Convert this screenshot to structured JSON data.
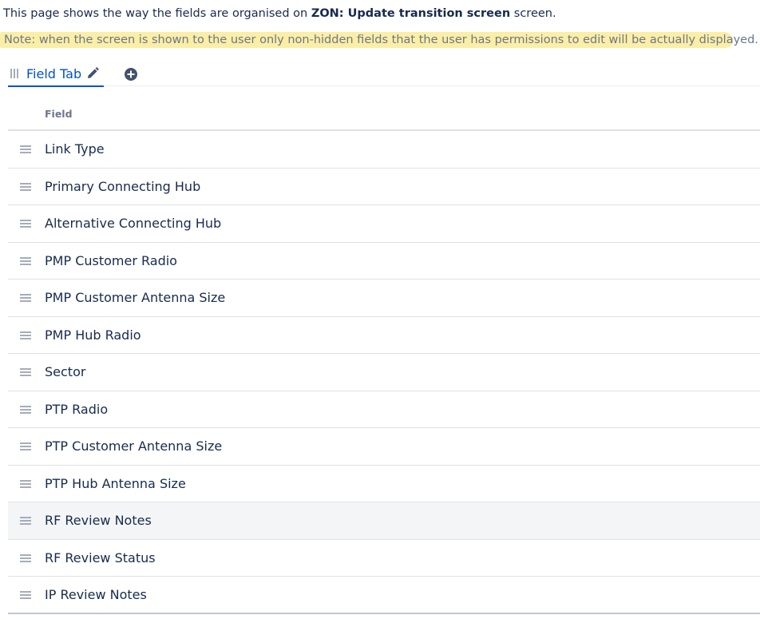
{
  "intro": {
    "prefix": "This page shows the way the fields are organised on ",
    "screen_name": "ZON: Update transition screen",
    "suffix": " screen."
  },
  "note": "Note: when the screen is shown to the user only non-hidden fields that the user has permissions to edit will be actually displayed.",
  "tabs": [
    {
      "label": "Field Tab"
    }
  ],
  "table": {
    "column_header": "Field",
    "rows": [
      {
        "label": "Link Type"
      },
      {
        "label": "Primary Connecting Hub"
      },
      {
        "label": "Alternative Connecting Hub"
      },
      {
        "label": "PMP Customer Radio"
      },
      {
        "label": "PMP Customer Antenna Size"
      },
      {
        "label": "PMP Hub Radio"
      },
      {
        "label": "Sector"
      },
      {
        "label": "PTP Radio"
      },
      {
        "label": "PTP Customer Antenna Size"
      },
      {
        "label": "PTP Hub Antenna Size"
      },
      {
        "label": "RF Review Notes"
      },
      {
        "label": "RF Review Status"
      },
      {
        "label": "IP Review Notes"
      }
    ]
  },
  "colors": {
    "link_blue": "#0052cc",
    "highlight": "#fbeea6",
    "note_text": "#6b778c",
    "hover_row": "#f4f5f7"
  },
  "icons": {
    "tab_grip": "drag-handle-icon",
    "edit": "pencil-icon",
    "add": "add-circle-icon",
    "row_grip": "drag-handle-icon"
  }
}
